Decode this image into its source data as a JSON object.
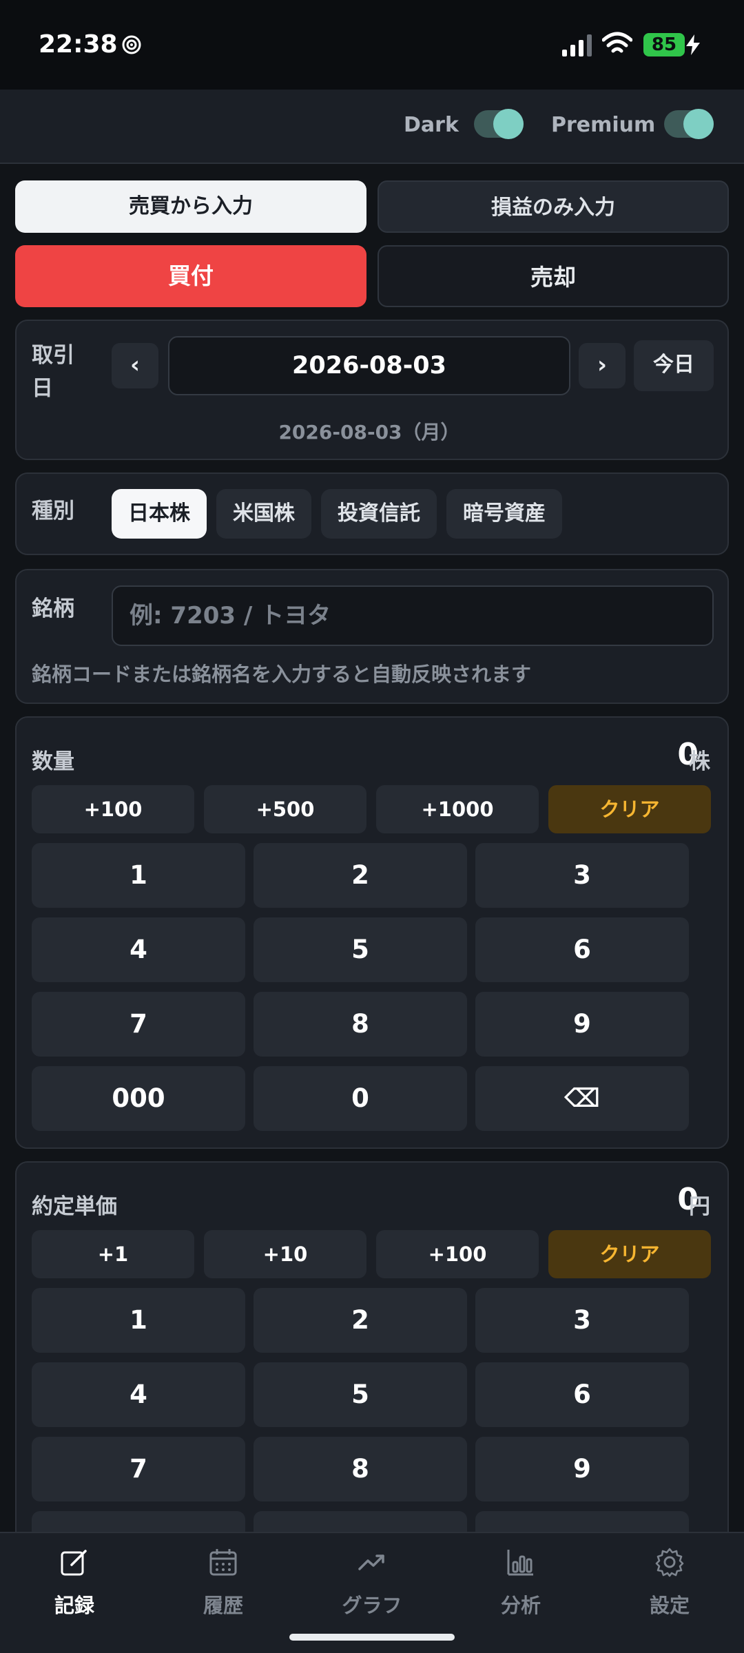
{
  "status": {
    "time": "22:38",
    "battery": "85"
  },
  "header": {
    "dark_label": "Dark",
    "premium_label": "Premium"
  },
  "mode_tabs": {
    "trade": "売買から入力",
    "pnl": "損益のみ入力"
  },
  "side_tabs": {
    "buy": "買付",
    "sell": "売却"
  },
  "trade_date": {
    "label": "取引日",
    "prev": "‹",
    "next": "›",
    "value": "2026-08-03",
    "today": "今日",
    "sub": "2026-08-03（月）"
  },
  "category": {
    "label": "種別",
    "options": [
      "日本株",
      "米国株",
      "投資信託",
      "暗号資産"
    ]
  },
  "symbol": {
    "label": "銘柄",
    "placeholder": "例: 7203 / トヨタ",
    "hint": "銘柄コードまたは銘柄名を入力すると自動反映されます"
  },
  "quantity": {
    "label": "数量",
    "value": "0",
    "unit": "株",
    "quick": [
      "+100",
      "+500",
      "+1000"
    ],
    "clear": "クリア",
    "keys": [
      "1",
      "2",
      "3",
      "4",
      "5",
      "6",
      "7",
      "8",
      "9",
      "000",
      "0",
      "⌫"
    ]
  },
  "price": {
    "label": "約定単価",
    "value": "0",
    "unit": "円",
    "quick": [
      "+1",
      "+10",
      "+100"
    ],
    "clear": "クリア",
    "keys": [
      "1",
      "2",
      "3",
      "4",
      "5",
      "6",
      "7",
      "8",
      "9"
    ]
  },
  "bottom_nav": {
    "items": [
      "記録",
      "履歴",
      "グラフ",
      "分析",
      "設定"
    ],
    "active_index": 0
  },
  "colors": {
    "buy": "#ef4444",
    "clear_text": "#f7b631",
    "toggle_on": "#7ecfc3"
  }
}
